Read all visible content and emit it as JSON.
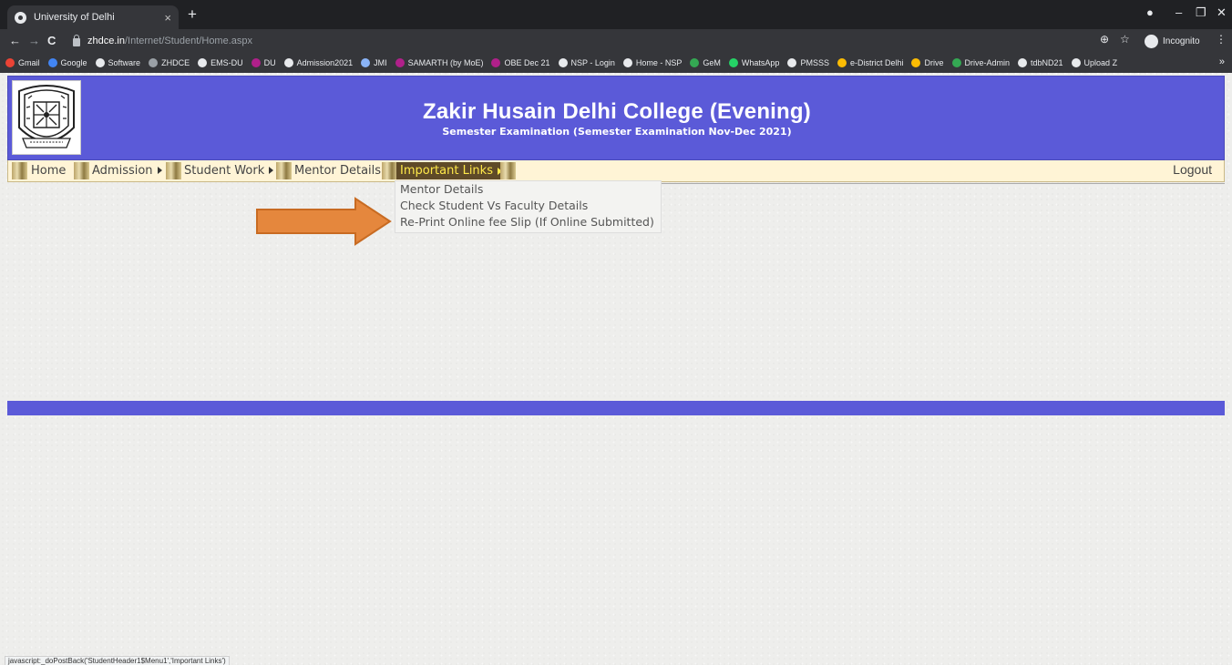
{
  "browser": {
    "tab_title": "University of Delhi",
    "tab_close": "×",
    "new_tab": "+",
    "win_min": "–",
    "win_max": "❐",
    "win_close": "✕",
    "back": "←",
    "forward": "→",
    "reload": "C",
    "url_host": "zhdce.in",
    "url_path": "/Internet/Student/Home.aspx",
    "zoom_icon": "⊕",
    "star_icon": "☆",
    "incognito_label": "Incognito",
    "menu_dots": "⋮",
    "bookmarks_more": "»",
    "bookmarks": [
      {
        "label": "Gmail",
        "color": "#ea4335"
      },
      {
        "label": "Google",
        "color": "#4285f4"
      },
      {
        "label": "Software",
        "color": "#e8eaed"
      },
      {
        "label": "ZHDCE",
        "color": "#9aa0a6"
      },
      {
        "label": "EMS-DU",
        "color": "#e8eaed"
      },
      {
        "label": "DU",
        "color": "#b0208a"
      },
      {
        "label": "Admission2021",
        "color": "#e8eaed"
      },
      {
        "label": "JMI",
        "color": "#8ab4f8"
      },
      {
        "label": "SAMARTH (by MoE)",
        "color": "#b0208a"
      },
      {
        "label": "OBE Dec 21",
        "color": "#b0208a"
      },
      {
        "label": "NSP - Login",
        "color": "#e8eaed"
      },
      {
        "label": "Home - NSP",
        "color": "#e8eaed"
      },
      {
        "label": "GeM",
        "color": "#34a853"
      },
      {
        "label": "WhatsApp",
        "color": "#25d366"
      },
      {
        "label": "PMSSS",
        "color": "#e8eaed"
      },
      {
        "label": "e-District Delhi",
        "color": "#fbbc04"
      },
      {
        "label": "Drive",
        "color": "#fbbc04"
      },
      {
        "label": "Drive-Admin",
        "color": "#34a853"
      },
      {
        "label": "tdbND21",
        "color": "#e8eaed"
      },
      {
        "label": "Upload Z",
        "color": "#e8eaed"
      }
    ]
  },
  "header": {
    "title": "Zakir Husain Delhi College (Evening)",
    "subtitle": "Semester Examination (Semester Examination Nov-Dec 2021)",
    "logo_text": "DELHI COLLEGE · EVENING · NEW DELHI · LIVE BY LOVE"
  },
  "menu": {
    "home": "Home",
    "admission": "Admission",
    "student_work": "Student Work",
    "mentor_details": "Mentor Details",
    "important_links": "Important Links",
    "logout": "Logout"
  },
  "dropdown": {
    "items": [
      "Mentor Details",
      "Check Student Vs Faculty Details",
      "Re-Print Online fee Slip (If Online Submitted)"
    ]
  },
  "colors": {
    "header_bg": "#5b5ad8",
    "menu_bg": "#fff4d6",
    "active_menu_bg": "#5f4a28",
    "active_menu_text": "#ffe94a",
    "arrow": "#e5873d"
  },
  "status_bar": "javascript:_doPostBack('StudentHeader1$Menu1','Important Links')"
}
